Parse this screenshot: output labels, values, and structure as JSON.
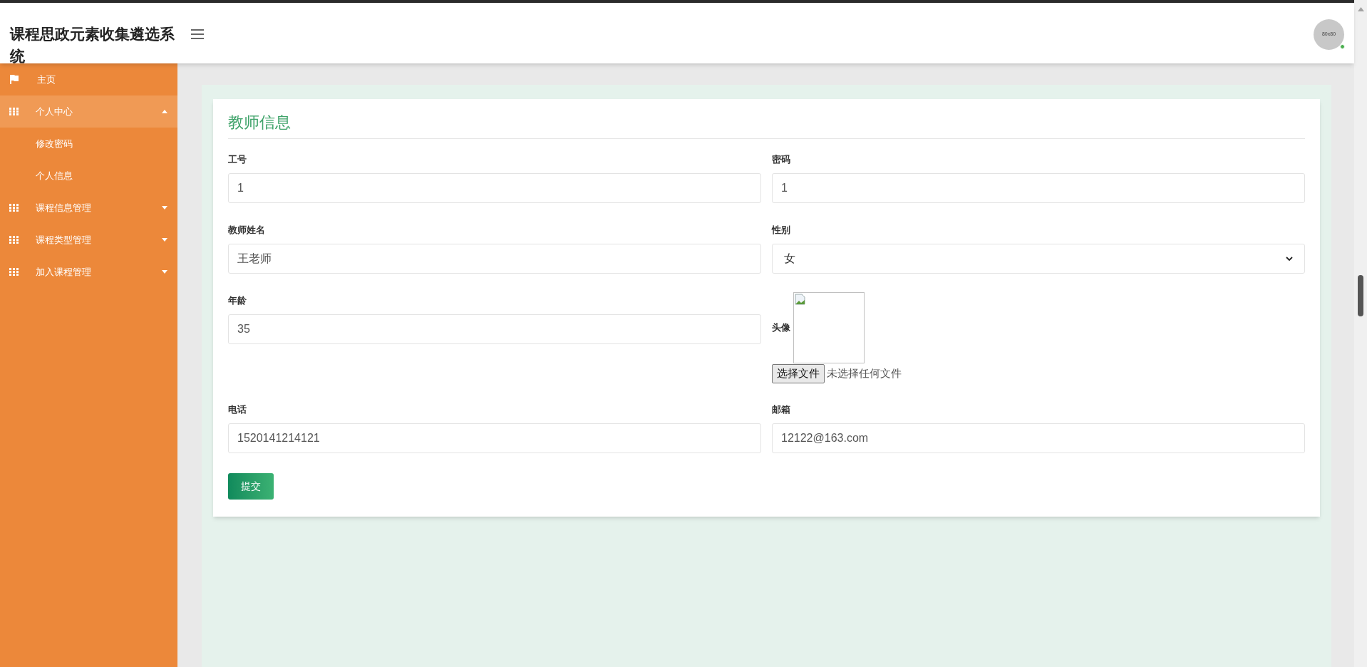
{
  "header": {
    "title": "课程思政元素收集遴选系统",
    "avatar_text": "80x80"
  },
  "sidebar": {
    "items": [
      {
        "label": "主页",
        "kind": "flag",
        "selected": false
      },
      {
        "label": "个人中心",
        "kind": "grid",
        "selected": true,
        "expanded": true,
        "children": [
          {
            "label": "修改密码"
          },
          {
            "label": "个人信息"
          }
        ]
      },
      {
        "label": "课程信息管理",
        "kind": "grid",
        "selected": false,
        "expanded": false
      },
      {
        "label": "课程类型管理",
        "kind": "grid",
        "selected": false,
        "expanded": false
      },
      {
        "label": "加入课程管理",
        "kind": "grid",
        "selected": false,
        "expanded": false
      }
    ]
  },
  "form": {
    "title": "教师信息",
    "fields": [
      {
        "label": "工号",
        "kind": "text",
        "value": "1"
      },
      {
        "label": "密码",
        "kind": "text",
        "value": "1"
      },
      {
        "label": "教师姓名",
        "kind": "text",
        "value": "王老师"
      },
      {
        "label": "性别",
        "kind": "select",
        "value": "女"
      },
      {
        "label": "年龄",
        "kind": "text",
        "value": "35"
      },
      {
        "label": "头像",
        "kind": "image",
        "button": "选择文件",
        "value": "未选择任何文件"
      },
      {
        "label": "电话",
        "kind": "text",
        "value": "1520141214121"
      },
      {
        "label": "邮箱",
        "kind": "text",
        "value": "12122@163.com"
      }
    ],
    "submit": "提交"
  }
}
